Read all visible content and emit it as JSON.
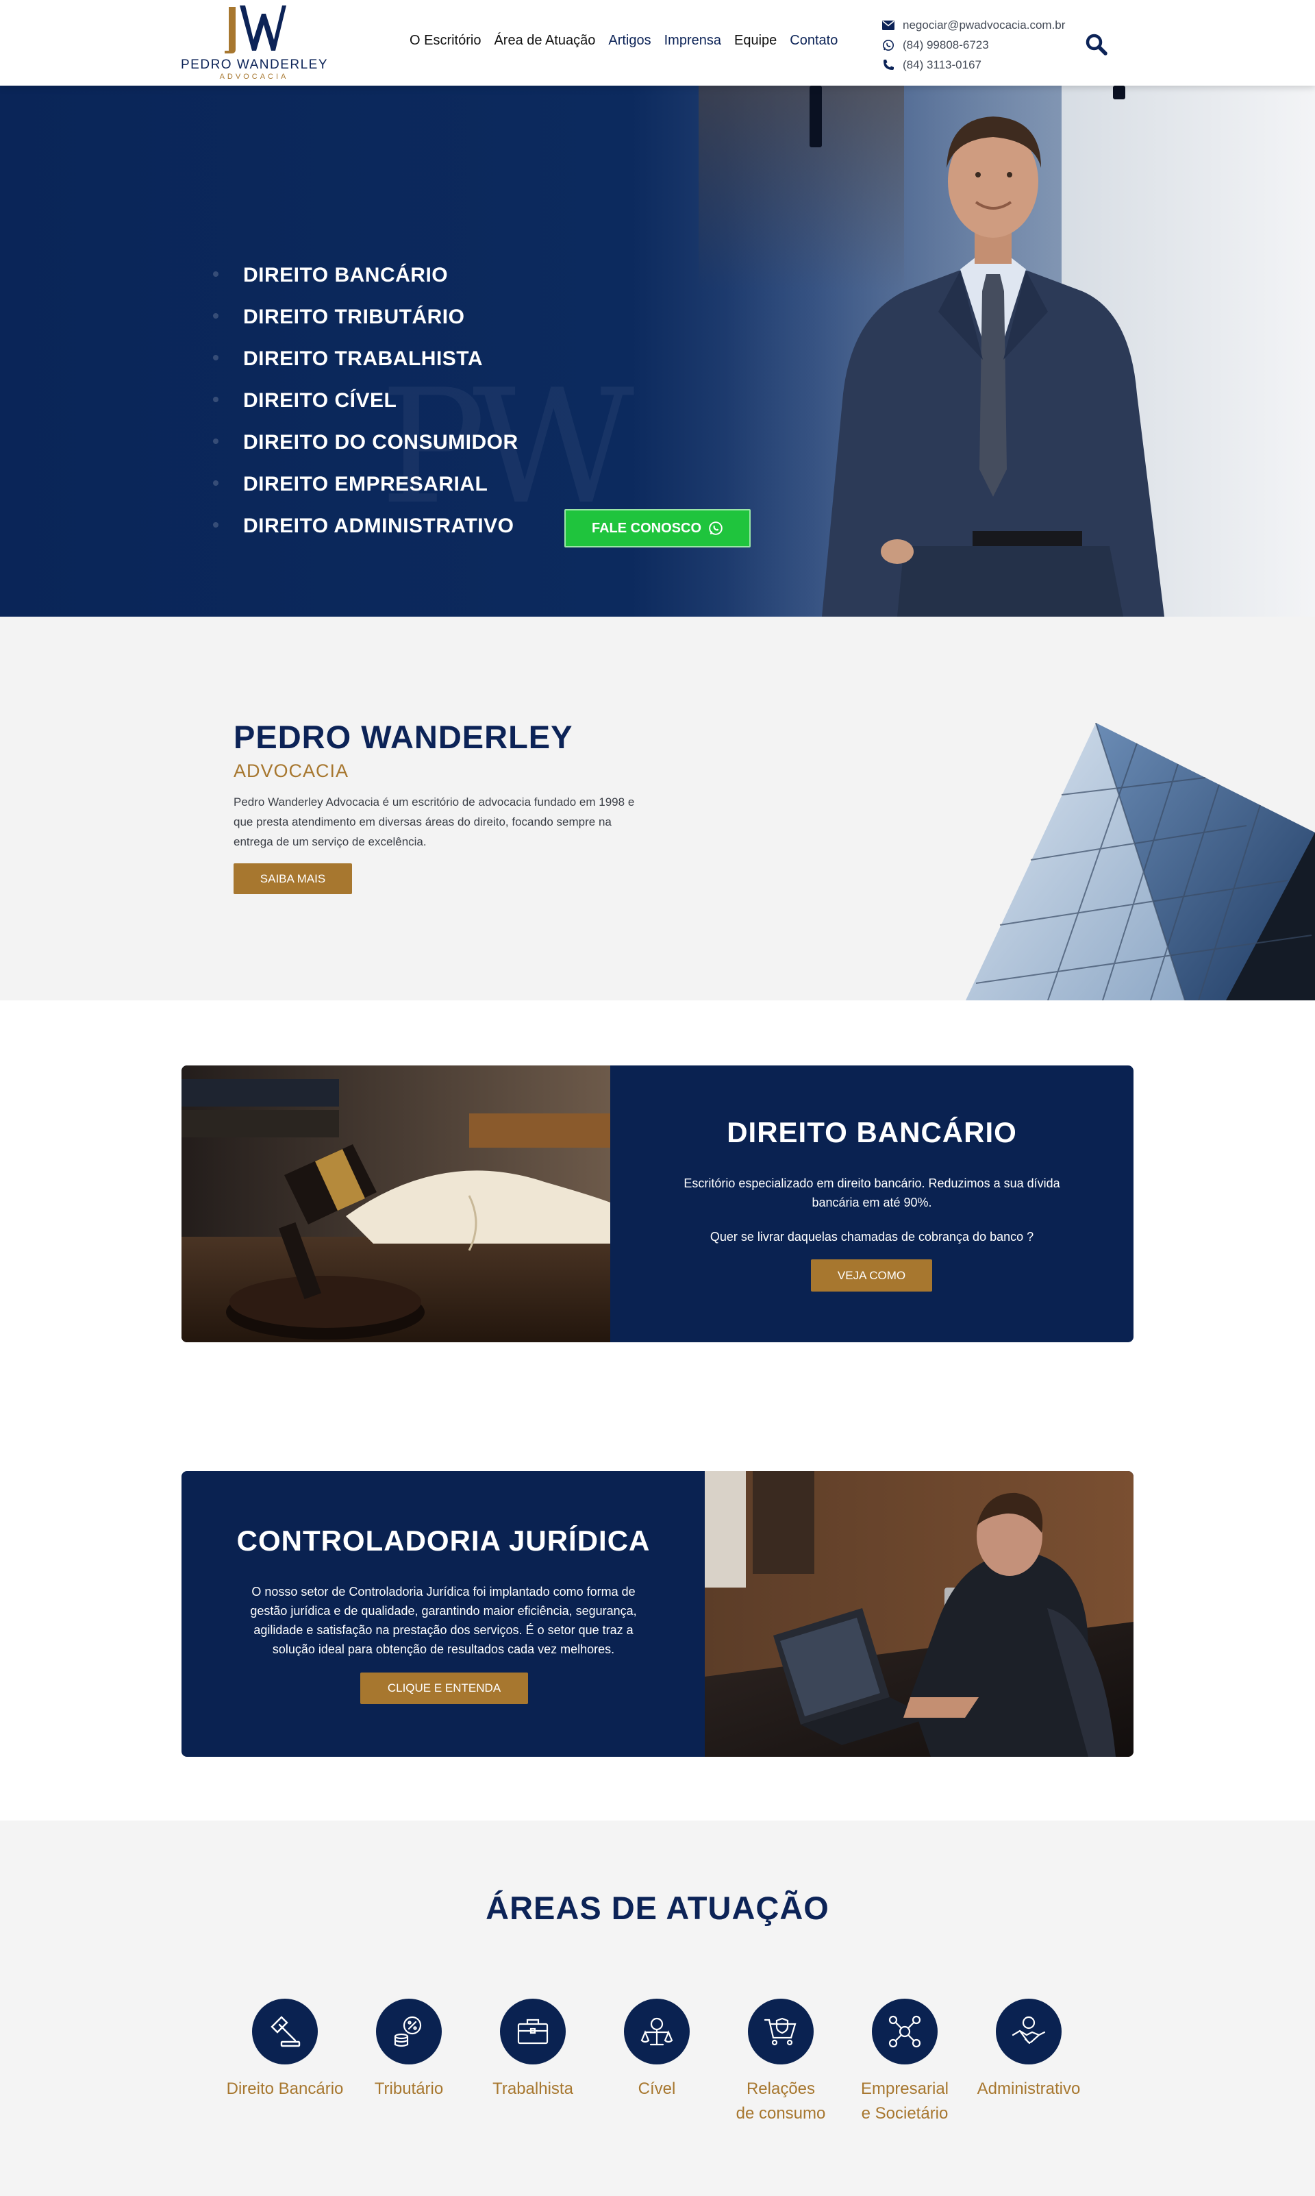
{
  "brand": {
    "logo_mark": "PW",
    "name": "PEDRO WANDERLEY",
    "subtitle": "ADVOCACIA"
  },
  "nav": {
    "items": [
      {
        "label": "O Escritório"
      },
      {
        "label": "Área de Atuação"
      },
      {
        "label": "Artigos"
      },
      {
        "label": "Imprensa"
      },
      {
        "label": "Equipe"
      },
      {
        "label": "Contato"
      }
    ]
  },
  "contact": {
    "email": "negociar@pwadvocacia.com.br",
    "whatsapp": "(84) 99808-6723",
    "phone": "(84) 3113-0167",
    "icons": [
      "envelope-icon",
      "whatsapp-icon",
      "phone-icon",
      "search-icon"
    ]
  },
  "hero": {
    "areas": [
      "DIREITO BANCÁRIO",
      "DIREITO TRIBUTÁRIO",
      "DIREITO TRABALHISTA",
      "DIREITO CÍVEL",
      "DIREITO DO CONSUMIDOR",
      "DIREITO EMPRESARIAL",
      "DIREITO ADMINISTRATIVO"
    ],
    "cta_label": "FALE CONOSCO"
  },
  "about": {
    "title": "PEDRO WANDERLEY",
    "subtitle": "ADVOCACIA",
    "text": "Pedro Wanderley Advocacia é um escritório de advocacia fundado em 1998 e que presta atendimento em diversas áreas do direito, focando sempre na entrega de um serviço de excelência.",
    "button": "SAIBA MAIS"
  },
  "banking": {
    "title": "DIREITO BANCÁRIO",
    "text1": "Escritório especializado em direito bancário. Reduzimos a sua dívida bancária em até 90%.",
    "text2": "Quer se livrar daquelas chamadas de cobrança do banco ?",
    "button": "VEJA COMO"
  },
  "controladoria": {
    "title": "CONTROLADORIA JURÍDICA",
    "text": "O nosso setor de Controladoria Jurídica foi implantado como forma de gestão jurídica e de qualidade, garantindo maior eficiência, segurança, agilidade e satisfação na prestação dos serviços. É o setor que traz a solução ideal para obtenção de resultados cada vez melhores.",
    "button": "CLIQUE E ENTENDA"
  },
  "areas": {
    "title": "ÁREAS DE ATUAÇÃO",
    "items": [
      {
        "label": "Direito Bancário",
        "icon": "gavel-icon"
      },
      {
        "label": "Tributário",
        "icon": "coins-percent-icon"
      },
      {
        "label": "Trabalhista",
        "icon": "briefcase-icon"
      },
      {
        "label": "Cível",
        "icon": "scales-icon"
      },
      {
        "label": "Relações\nde consumo",
        "icon": "shopping-cart-shield-icon"
      },
      {
        "label": "Empresarial\ne Societário",
        "icon": "network-people-icon"
      },
      {
        "label": "Administrativo",
        "icon": "handshake-icon"
      }
    ]
  },
  "colors": {
    "navy": "#0a2251",
    "gold": "#a7772f",
    "whatsapp_green": "#1fc43d",
    "light_bg": "#f3f3f3"
  }
}
